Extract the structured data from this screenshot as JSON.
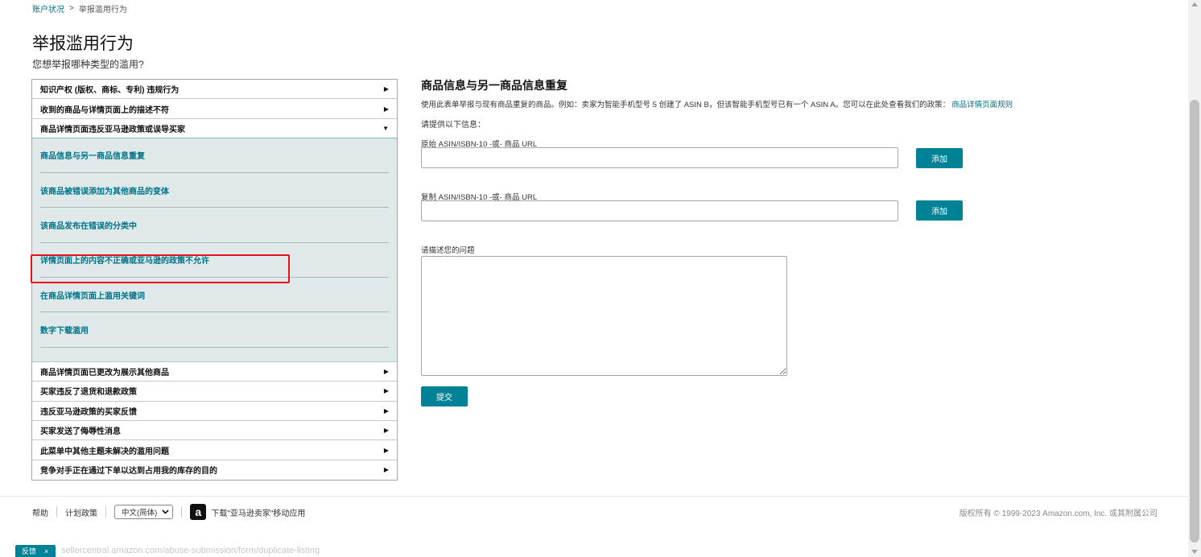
{
  "breadcrumb": {
    "parent": "账户状况",
    "separator": ">",
    "current": "举报滥用行为"
  },
  "header": {
    "title": "举报滥用行为",
    "subtitle": "您想举报哪种类型的滥用?"
  },
  "accordion": {
    "items_before": [
      {
        "label": "知识产权 (版权、商标、专利) 违规行为",
        "arrow": "▶"
      },
      {
        "label": "收到的商品与详情页面上的描述不符",
        "arrow": "▶"
      }
    ],
    "open_item": {
      "label": "商品详情页面违反亚马逊政策或误导买家",
      "arrow": "▼"
    },
    "sub_items": [
      "商品信息与另一商品信息重复",
      "该商品被错误添加为其他商品的变体",
      "该商品发布在错误的分类中",
      "详情页面上的内容不正确或亚马逊的政策不允许",
      "在商品详情页面上滥用关键词",
      "数字下载滥用"
    ],
    "items_after": [
      {
        "label": "商品详情页面已更改为展示其他商品",
        "arrow": "▶"
      },
      {
        "label": "买家违反了退货和退款政策",
        "arrow": "▶"
      },
      {
        "label": "违反亚马逊政策的买家反馈",
        "arrow": "▶"
      },
      {
        "label": "买家发送了侮辱性消息",
        "arrow": "▶"
      },
      {
        "label": "此菜单中其他主题未解决的滥用问题",
        "arrow": "▶"
      },
      {
        "label": "竞争对手正在通过下单以达到占用我的库存的目的",
        "arrow": "▶"
      }
    ]
  },
  "form": {
    "title": "商品信息与另一商品信息重复",
    "description": "使用此表单举报与现有商品重复的商品。例如：卖家为智能手机型号 5 创建了 ASIN B，但该智能手机型号已有一个 ASIN A。您可以在此处查看我们的政策：",
    "policy_link": "商品详情页面规则",
    "prompt": "请提供以下信息：",
    "original_label": "原始 ASIN/ISBN-10 -或- 商品 URL",
    "original_value": "",
    "add_label_1": "添加",
    "duplicate_label": "复制 ASIN/ISBN-10 -或- 商品 URL",
    "duplicate_value": "",
    "add_label_2": "添加",
    "describe_label": "请描述您的问题",
    "describe_value": "",
    "submit_label": "提交"
  },
  "footer": {
    "help": "帮助",
    "policy": "计划政策",
    "language": "中文(简体)",
    "app_download": "下载\"亚马逊卖家\"移动应用",
    "copyright": "版权所有 © 1999-2023 Amazon.com, Inc. 或其附属公司"
  },
  "feedback": {
    "label": "反馈",
    "close": "×"
  },
  "status_url": "sellercentral.amazon.com/abuse-submission/form/duplicate-listing",
  "colors": {
    "accent": "#008296",
    "link": "#007185",
    "highlight": "#e3121b",
    "panel_bg": "#dfe9ea"
  },
  "icons": {
    "arrow_right": "caret-right-icon",
    "arrow_down": "caret-down-icon",
    "select": "chevron-down-icon",
    "amazon": "amazon-a-icon"
  }
}
